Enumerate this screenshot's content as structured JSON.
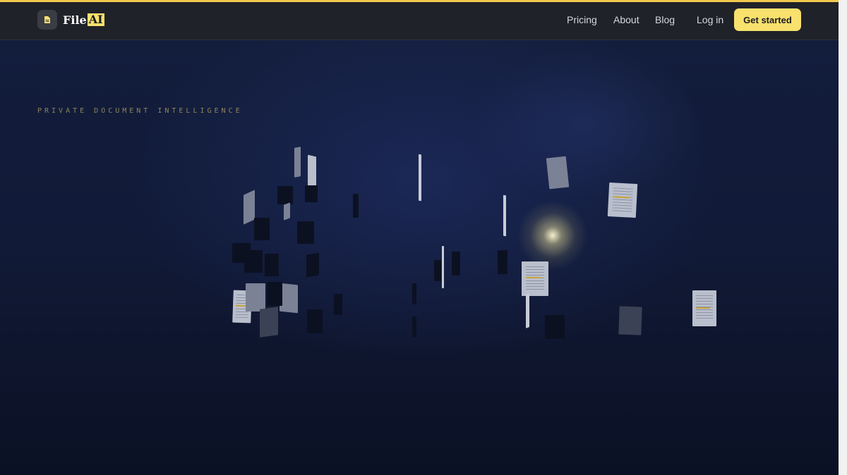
{
  "brand": {
    "name_prefix": "File",
    "name_highlight": "AI",
    "accent": "#f8e16c",
    "logo_icon": "document-icon"
  },
  "nav": {
    "links": [
      "Pricing",
      "About",
      "Blog"
    ],
    "login": "Log in",
    "cta": "Get started"
  },
  "hero": {
    "eyebrow": "PRIVATE DOCUMENT INTELLIGENCE",
    "background": "#111a37"
  }
}
